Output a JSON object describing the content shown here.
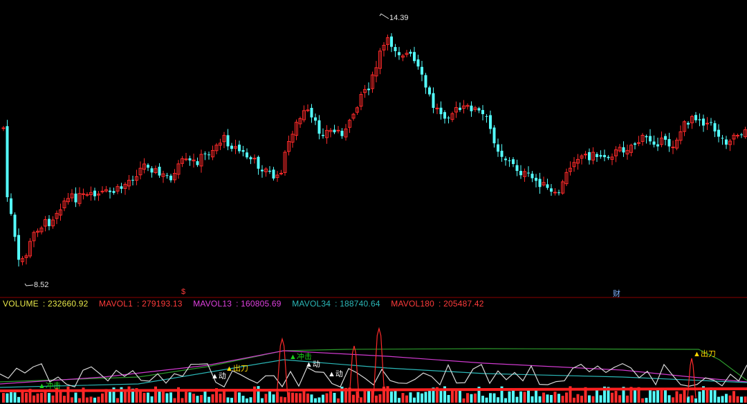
{
  "chart_data": {
    "type": "candlestick",
    "price_panel": {
      "high_marker": "14.39",
      "low_marker": "8.52",
      "event_markers": [
        {
          "label": "$",
          "color": "#ff3b3b"
        },
        {
          "label": "财",
          "color": "#7fb2ff"
        }
      ]
    },
    "volume_panel": {
      "legend": [
        {
          "name": "VOLUME",
          "value": "232660.92",
          "color": "#e8e84a"
        },
        {
          "name": "MAVOL1",
          "value": "279193.13",
          "color": "#ff3b3b"
        },
        {
          "name": "MAVOL13",
          "value": "160805.69",
          "color": "#e040e0"
        },
        {
          "name": "MAVOL34",
          "value": "188740.64",
          "color": "#2bb8b8"
        },
        {
          "name": "MAVOL180",
          "value": "205487.42",
          "color": "#ff3b3b"
        }
      ],
      "signals": [
        {
          "label": "出刀",
          "color": "#ffd800"
        },
        {
          "label": "出刀",
          "color": "#ffd800"
        },
        {
          "label": "冲击",
          "color": "#19d119"
        },
        {
          "label": "冲击",
          "color": "#19d119"
        },
        {
          "label": "动",
          "color": "#ffffff"
        },
        {
          "label": "动",
          "color": "#ffffff"
        },
        {
          "label": "动",
          "color": "#ffffff"
        }
      ]
    }
  }
}
